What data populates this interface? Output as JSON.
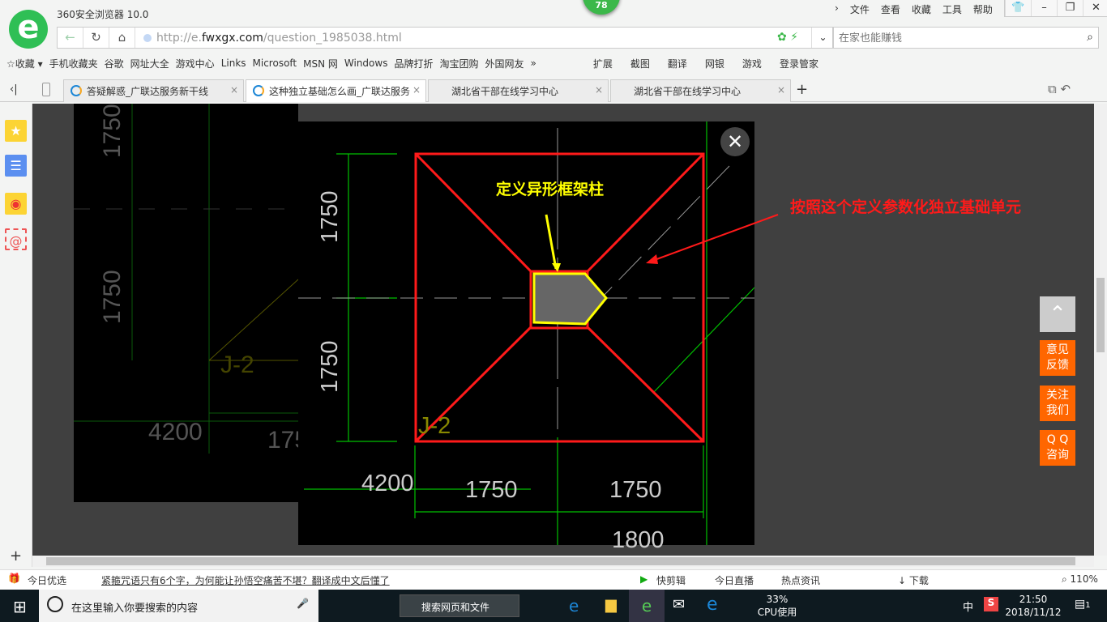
{
  "browser": {
    "title": "360安全浏览器 10.0",
    "badge": "78",
    "menu": [
      "文件",
      "查看",
      "收藏",
      "工具",
      "帮助"
    ],
    "url_prefix": "http://e.",
    "url_domain": "fwxgx.com",
    "url_path": "/question_1985038.html",
    "search_placeholder": "在家也能赚钱"
  },
  "bookmarks": [
    "收藏",
    "手机收藏夹",
    "谷歌",
    "网址大全",
    "游戏中心",
    "Links",
    "Microsoft",
    "MSN 网",
    "Windows",
    "品牌打折",
    "淘宝团购",
    "外国网友",
    "»"
  ],
  "extensions": [
    "扩展",
    "截图",
    "翻译",
    "网银",
    "游戏",
    "登录管家"
  ],
  "tabs": [
    {
      "label": "答疑解惑_广联达服务新干线"
    },
    {
      "label": "这种独立基础怎么画_广联达服务"
    },
    {
      "label": "湖北省干部在线学习中心"
    },
    {
      "label": "湖北省干部在线学习中心"
    }
  ],
  "drawing": {
    "annotation_column": "定义异形框架柱",
    "annotation_base": "按照这个定义参数化独立基础单元",
    "dims": {
      "v1": "1750",
      "v2": "1750",
      "h1": "1750",
      "h2": "1750",
      "left": "4200",
      "bottom": "1800",
      "label": "J-2"
    },
    "bg_dims": {
      "v1": "1750",
      "v2": "1750",
      "left": "4200",
      "partial": "175",
      "label": "J-2"
    }
  },
  "float_buttons": [
    "意见\n反馈",
    "关注\n我们",
    "Q Q\n咨询"
  ],
  "status": {
    "left": "今日优选",
    "news": "紧箍咒语只有6个字，为何能让孙悟空痛苦不堪？翻译成中文后懂了",
    "items": [
      "快剪辑",
      "今日直播",
      "热点资讯",
      "下载"
    ],
    "zoom": "110%"
  },
  "taskbar": {
    "search": "在这里输入你要搜索的内容",
    "search2": "搜索网页和文件",
    "cpu": "33%",
    "cpu_label": "CPU使用",
    "ime": "中",
    "time": "21:50",
    "date": "2018/11/12",
    "notif": "1"
  },
  "colors": {
    "red": "#ff1a1a",
    "yellow": "#ffff00",
    "green": "#00c000",
    "float": "#ff6600"
  }
}
